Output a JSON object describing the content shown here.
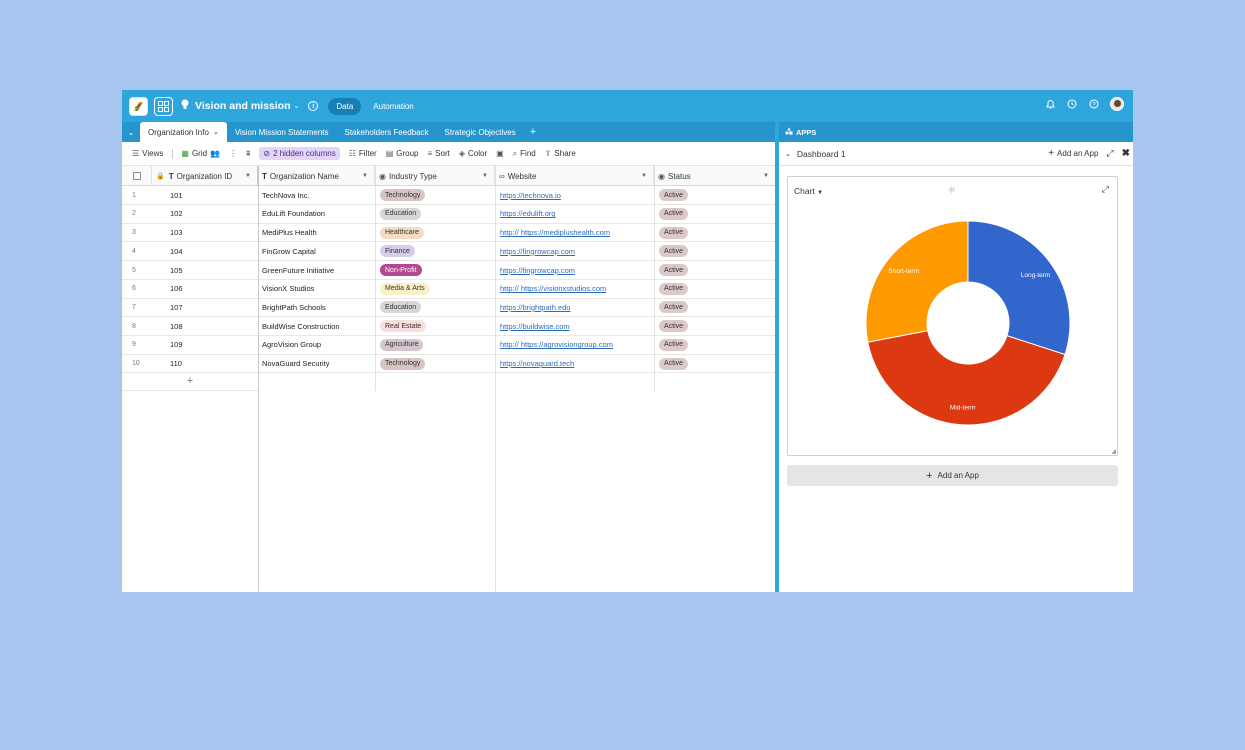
{
  "header": {
    "base_title": "Vision and mission",
    "data_label": "Data",
    "automation_label": "Automation"
  },
  "tabs": [
    {
      "label": "Organization Info",
      "active": true
    },
    {
      "label": "Vision Mission Statements"
    },
    {
      "label": "Stakeholders Feedback"
    },
    {
      "label": "Strategic Objectives"
    }
  ],
  "toolbar": {
    "views": "Views",
    "grid": "Grid",
    "hidden_columns": "2 hidden columns",
    "filter": "Filter",
    "group": "Group",
    "sort": "Sort",
    "color": "Color",
    "find": "Find",
    "share": "Share"
  },
  "columns": {
    "org_id": "Organization ID",
    "org_name": "Organization Name",
    "industry": "Industry Type",
    "website": "Website",
    "status": "Status"
  },
  "rows": [
    {
      "n": "1",
      "id": "101",
      "name": "TechNova Inc.",
      "industry": "Technology",
      "website": "https://technova.io",
      "status": "Active"
    },
    {
      "n": "2",
      "id": "102",
      "name": "EduLift Foundation",
      "industry": "Education",
      "website": "https://edulift.org",
      "status": "Active"
    },
    {
      "n": "3",
      "id": "103",
      "name": "MediPlus Health",
      "industry": "Healthcare",
      "website": "http:// https://mediplushealth.com",
      "status": "Active"
    },
    {
      "n": "4",
      "id": "104",
      "name": "FinGrow Capital",
      "industry": "Finance",
      "website": "https://fingrowcap.com",
      "status": "Active"
    },
    {
      "n": "5",
      "id": "105",
      "name": "GreenFuture Initiative",
      "industry": "Non-Profit",
      "website": "https://fingrowcap.com",
      "status": "Active"
    },
    {
      "n": "6",
      "id": "106",
      "name": "VisionX Studios",
      "industry": "Media & Arts",
      "website": "http:// https://visionxstudios.com",
      "status": "Active"
    },
    {
      "n": "7",
      "id": "107",
      "name": "BrightPath Schools",
      "industry": "Education",
      "website": "https://brightpath.edu",
      "status": "Active"
    },
    {
      "n": "8",
      "id": "108",
      "name": "BuildWise Construction",
      "industry": "Real Estate",
      "website": "https://buildwise.com",
      "status": "Active"
    },
    {
      "n": "9",
      "id": "109",
      "name": "AgroVision Group",
      "industry": "Agriculture",
      "website": "http:// https://agrovisiongroup.com",
      "status": "Active"
    },
    {
      "n": "10",
      "id": "110",
      "name": "NovaGuard Security",
      "industry": "Technology",
      "website": "https://novaguard.tech",
      "status": "Active"
    }
  ],
  "industry_colors": {
    "Technology": "#d9c4c4",
    "Education": "#d6d6d6",
    "Healthcare": "#f3dcc4",
    "Finance": "#d8ccec",
    "Non-Profit": "#b3498f",
    "Media & Arts": "#fbf1c8",
    "Real Estate": "#f9dede",
    "Agriculture": "#d7c6cf"
  },
  "status_color": "#dcc8c8",
  "apps": {
    "header": "APPS",
    "dashboard": "Dashboard 1",
    "add_app": "Add an App",
    "chart_selector": "Chart",
    "add_app_button": "Add an App"
  },
  "chart_data": {
    "type": "pie",
    "donut": true,
    "categories": [
      "Long-term",
      "Mid-term",
      "Short-term"
    ],
    "values": [
      30,
      42,
      28
    ],
    "colors": [
      "#3366cc",
      "#dc3912",
      "#ff9900"
    ]
  }
}
